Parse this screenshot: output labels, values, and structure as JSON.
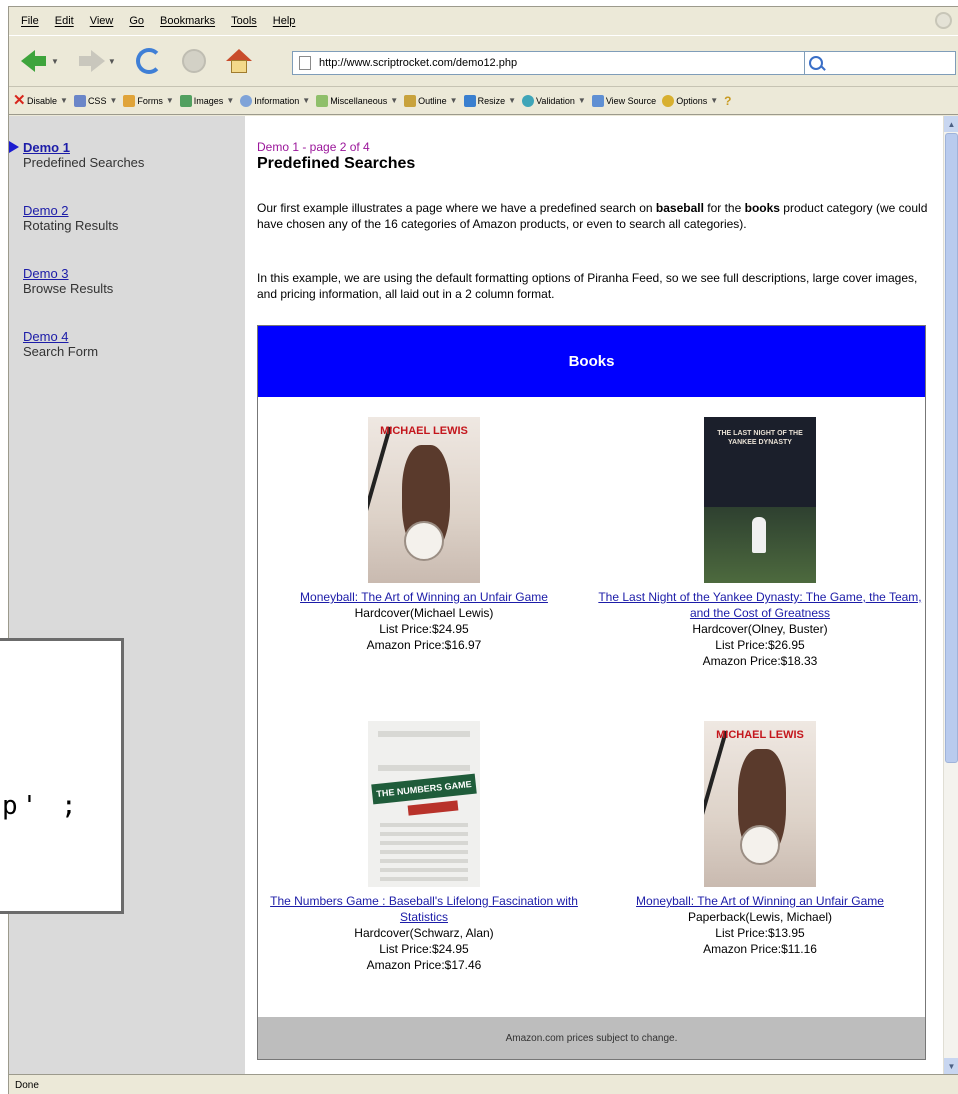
{
  "menu": [
    "File",
    "Edit",
    "View",
    "Go",
    "Bookmarks",
    "Tools",
    "Help"
  ],
  "url": "http://www.scriptrocket.com/demo12.php",
  "devbar": [
    "Disable",
    "CSS",
    "Forms",
    "Images",
    "Information",
    "Miscellaneous",
    "Outline",
    "Resize",
    "Validation",
    "View Source",
    "Options"
  ],
  "devbar_colors": [
    "#d8261c",
    "#6b86c8",
    "#e0a43a",
    "#52a060",
    "#7fa3d8",
    "#8fbf6a",
    "#c8a23c",
    "#3a7fcf",
    "#3fa5b8",
    "#5f8fd3",
    "#d8b030"
  ],
  "sidebar": [
    {
      "title": "Demo 1",
      "desc": "Predefined Searches"
    },
    {
      "title": "Demo 2",
      "desc": "Rotating Results"
    },
    {
      "title": "Demo 3",
      "desc": "Browse Results"
    },
    {
      "title": "Demo 4",
      "desc": "Search Form"
    }
  ],
  "content": {
    "crumb": "Demo 1 - page 2 of 4",
    "heading": "Predefined Searches",
    "p1_a": "Our first example illustrates a page where we have a predefined search on ",
    "p1_b": "baseball",
    "p1_c": " for the ",
    "p1_d": "books",
    "p1_e": " product category (we could have chosen any of the 16 categories of Amazon products, or even to search all categories).",
    "p2": "In this example, we are using the default formatting options of Piranha Feed, so we see full descriptions, large cover images, and pricing information, all laid out in a 2 column format."
  },
  "panel": {
    "header": "Books",
    "footer": "Amazon.com prices subject to change.",
    "products": [
      {
        "title": "Moneyball: The Art of Winning an Unfair Game",
        "binding": "Hardcover(Michael Lewis)",
        "list": "List Price:$24.95",
        "amazon": "Amazon Price:$16.97",
        "cover_text": "MICHAEL LEWIS"
      },
      {
        "title": "The Last Night of the Yankee Dynasty: The Game, the Team, and the Cost of Greatness",
        "binding": "Hardcover(Olney, Buster)",
        "list": "List Price:$26.95",
        "amazon": "Amazon Price:$18.33",
        "cover_text": "THE LAST NIGHT OF THE YANKEE DYNASTY"
      },
      {
        "title": "The Numbers Game : Baseball's Lifelong Fascination with Statistics",
        "binding": "Hardcover(Schwarz, Alan)",
        "list": "List Price:$24.95",
        "amazon": "Amazon Price:$17.46",
        "cover_text": "THE NUMBERS GAME"
      },
      {
        "title": "Moneyball: The Art of Winning an Unfair Game",
        "binding": "Paperback(Lewis, Michael)",
        "list": "List Price:$13.95",
        "amazon": "Amazon Price:$11.16",
        "cover_text": "MICHAEL LEWIS"
      }
    ]
  },
  "status": "Done",
  "overlay_text": "p' ;"
}
